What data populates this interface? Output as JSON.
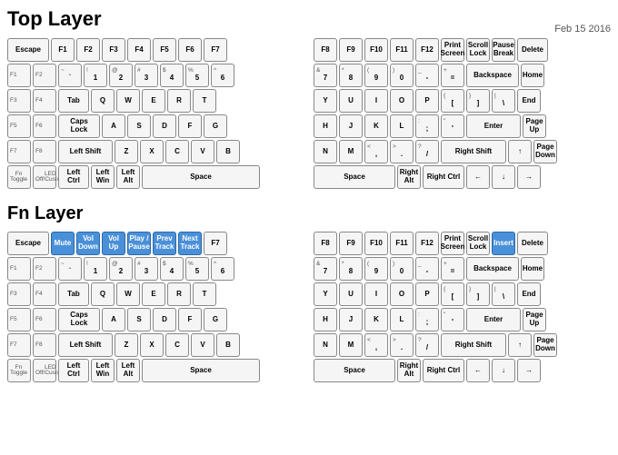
{
  "topLayer": {
    "title": "Top Layer",
    "date": "Feb 15 2016",
    "leftHalf": {
      "rows": [
        [
          {
            "label": "Escape",
            "w": "w2"
          },
          {
            "label": "F1",
            "w": "w1"
          },
          {
            "label": "F2",
            "w": "w1"
          },
          {
            "label": "F3",
            "w": "w1"
          },
          {
            "label": "F4",
            "w": "w1"
          },
          {
            "label": "F5",
            "w": "w1"
          },
          {
            "label": "F6",
            "w": "w1"
          },
          {
            "label": "F7",
            "w": "w1"
          }
        ],
        [
          {
            "top": "F1",
            "main": "F1",
            "w": "w1"
          },
          {
            "top": "F2",
            "main": "F2",
            "w": "w1"
          },
          {
            "top": "~",
            "bot": "`",
            "w": "w1"
          },
          {
            "top": "!",
            "bot": "1",
            "w": "w1"
          },
          {
            "top": "@",
            "bot": "2",
            "w": "w1"
          },
          {
            "top": "#",
            "bot": "3",
            "w": "w1"
          },
          {
            "top": "$",
            "bot": "4",
            "w": "w1"
          },
          {
            "top": "%",
            "bot": "5",
            "w": "w1"
          },
          {
            "top": "^",
            "bot": "6",
            "w": "w1"
          }
        ],
        [
          {
            "top": "F3",
            "main": "F3",
            "w": "w1"
          },
          {
            "top": "F4",
            "main": "F4",
            "w": "w1"
          },
          {
            "label": "Tab",
            "w": "w15"
          },
          {
            "label": "Q",
            "w": "w1"
          },
          {
            "label": "W",
            "w": "w1"
          },
          {
            "label": "E",
            "w": "w1"
          },
          {
            "label": "R",
            "w": "w1"
          },
          {
            "label": "T",
            "w": "w1"
          }
        ],
        [
          {
            "top": "F5",
            "main": "F5",
            "w": "w1"
          },
          {
            "top": "F6",
            "main": "F6",
            "w": "w1"
          },
          {
            "label": "Caps Lock",
            "w": "w2"
          },
          {
            "label": "A",
            "w": "w1"
          },
          {
            "label": "S",
            "w": "w1"
          },
          {
            "label": "D",
            "w": "w1"
          },
          {
            "label": "F",
            "w": "w1"
          },
          {
            "label": "G",
            "w": "w1"
          }
        ],
        [
          {
            "top": "F7",
            "main": "F7",
            "w": "w1"
          },
          {
            "top": "F8",
            "main": "F8",
            "w": "w1"
          },
          {
            "label": "Left Shift",
            "w": "w25"
          },
          {
            "label": "Z",
            "w": "w1"
          },
          {
            "label": "X",
            "w": "w1"
          },
          {
            "label": "C",
            "w": "w1"
          },
          {
            "label": "V",
            "w": "w1"
          },
          {
            "label": "B",
            "w": "w1"
          }
        ],
        [
          {
            "top": "Fn\nToggle",
            "main": "",
            "w": "w1"
          },
          {
            "top": "LED\nOff/Custom",
            "main": "",
            "w": "w1"
          },
          {
            "label": "Left Ctrl",
            "w": "w15"
          },
          {
            "label": "Left\nWin",
            "w": "w1"
          },
          {
            "label": "Left\nAlt",
            "w": "w1"
          },
          {
            "label": "Space",
            "w": "w-space"
          }
        ]
      ]
    },
    "rightHalf": {
      "rows": [
        [
          {
            "label": "F8",
            "w": "w1"
          },
          {
            "label": "F9",
            "w": "w1"
          },
          {
            "label": "F10",
            "w": "w1"
          },
          {
            "label": "F11",
            "w": "w1"
          },
          {
            "label": "F12",
            "w": "w1"
          },
          {
            "label": "Print\nScreen",
            "w": "w1"
          },
          {
            "label": "Scroll\nLock",
            "w": "w1"
          },
          {
            "label": "Pause\nBreak",
            "w": "w1"
          },
          {
            "label": "Delete",
            "w": "w15"
          }
        ],
        [
          {
            "top": "&",
            "bot": "7",
            "w": "w1"
          },
          {
            "top": "*",
            "bot": "8",
            "w": "w1"
          },
          {
            "top": "(",
            "bot": "9",
            "w": "w1"
          },
          {
            "top": ")",
            "bot": "0",
            "w": "w1"
          },
          {
            "top": "_",
            "bot": "-",
            "w": "w1"
          },
          {
            "top": "+",
            "bot": "=",
            "w": "w1"
          },
          {
            "label": "Backspace",
            "w": "w-backspace"
          },
          {
            "label": "Home",
            "w": "w1"
          }
        ],
        [
          {
            "label": "Y",
            "w": "w1"
          },
          {
            "label": "U",
            "w": "w1"
          },
          {
            "label": "I",
            "w": "w1"
          },
          {
            "label": "O",
            "w": "w1"
          },
          {
            "label": "P",
            "w": "w1"
          },
          {
            "top": "{",
            "bot": "[",
            "w": "w1"
          },
          {
            "top": "}",
            "bot": "]",
            "w": "w1"
          },
          {
            "top": "|",
            "bot": "\\",
            "w": "w1"
          },
          {
            "label": "End",
            "w": "w1"
          }
        ],
        [
          {
            "label": "H",
            "w": "w1"
          },
          {
            "label": "J",
            "w": "w1"
          },
          {
            "label": "K",
            "w": "w1"
          },
          {
            "label": "L",
            "w": "w1"
          },
          {
            "top": ":",
            "bot": ";",
            "w": "w1"
          },
          {
            "top": "\"",
            "bot": "'",
            "w": "w1"
          },
          {
            "label": "Enter",
            "w": "w25"
          },
          {
            "label": "Page\nUp",
            "w": "w1"
          }
        ],
        [
          {
            "label": "N",
            "w": "w1"
          },
          {
            "label": "M",
            "w": "w1"
          },
          {
            "top": "<",
            "bot": ",",
            "w": "w1"
          },
          {
            "top": ">",
            "bot": ".",
            "w": "w1"
          },
          {
            "top": "?",
            "bot": "/",
            "w": "w1"
          },
          {
            "label": "Right Shift",
            "w": "w3"
          },
          {
            "label": "↑",
            "w": "w1"
          },
          {
            "label": "Page\nDown",
            "w": "w1"
          }
        ],
        [
          {
            "label": "Space",
            "w": "w4"
          },
          {
            "label": "Right\nAlt",
            "w": "w1"
          },
          {
            "label": "Right Ctrl",
            "w": "w2"
          },
          {
            "label": "←",
            "w": "w1"
          },
          {
            "label": "↓",
            "w": "w1"
          },
          {
            "label": "→",
            "w": "w1"
          }
        ]
      ]
    }
  },
  "fnLayer": {
    "title": "Fn Layer",
    "leftHalf": {
      "rows": [
        [
          {
            "label": "Escape",
            "w": "w2"
          },
          {
            "label": "Mute",
            "w": "w1",
            "blue": true
          },
          {
            "label": "Vol\nDown",
            "w": "w1",
            "blue": true
          },
          {
            "label": "Vol\nUp",
            "w": "w1",
            "blue": true
          },
          {
            "label": "Play /\nPause",
            "w": "w1",
            "blue": true
          },
          {
            "label": "Prev\nTrack",
            "w": "w1",
            "blue": true
          },
          {
            "label": "Next\nTrack",
            "w": "w1",
            "blue": true
          },
          {
            "label": "F7",
            "w": "w1"
          }
        ],
        [
          {
            "top": "F1",
            "main": "F1",
            "w": "w1"
          },
          {
            "top": "F2",
            "main": "F2",
            "w": "w1"
          },
          {
            "top": "~",
            "bot": "`",
            "w": "w1"
          },
          {
            "top": "!",
            "bot": "1",
            "w": "w1"
          },
          {
            "top": "@",
            "bot": "2",
            "w": "w1"
          },
          {
            "top": "#",
            "bot": "3",
            "w": "w1"
          },
          {
            "top": "$",
            "bot": "4",
            "w": "w1"
          },
          {
            "top": "%",
            "bot": "5",
            "w": "w1"
          },
          {
            "top": "^",
            "bot": "6",
            "w": "w1"
          }
        ],
        [
          {
            "top": "F3",
            "main": "F3",
            "w": "w1"
          },
          {
            "top": "F4",
            "main": "F4",
            "w": "w1"
          },
          {
            "label": "Tab",
            "w": "w15"
          },
          {
            "label": "Q",
            "w": "w1"
          },
          {
            "label": "W",
            "w": "w1"
          },
          {
            "label": "E",
            "w": "w1"
          },
          {
            "label": "R",
            "w": "w1"
          },
          {
            "label": "T",
            "w": "w1"
          }
        ],
        [
          {
            "top": "F5",
            "main": "F5",
            "w": "w1"
          },
          {
            "top": "F6",
            "main": "F6",
            "w": "w1"
          },
          {
            "label": "Caps Lock",
            "w": "w2"
          },
          {
            "label": "A",
            "w": "w1"
          },
          {
            "label": "S",
            "w": "w1"
          },
          {
            "label": "D",
            "w": "w1"
          },
          {
            "label": "F",
            "w": "w1"
          },
          {
            "label": "G",
            "w": "w1"
          }
        ],
        [
          {
            "top": "F7",
            "main": "F7",
            "w": "w1"
          },
          {
            "top": "F8",
            "main": "F8",
            "w": "w1"
          },
          {
            "label": "Left Shift",
            "w": "w25"
          },
          {
            "label": "Z",
            "w": "w1"
          },
          {
            "label": "X",
            "w": "w1"
          },
          {
            "label": "C",
            "w": "w1"
          },
          {
            "label": "V",
            "w": "w1"
          },
          {
            "label": "B",
            "w": "w1"
          }
        ],
        [
          {
            "top": "Fn\nToggle",
            "main": "",
            "w": "w1"
          },
          {
            "top": "LED\nOff/Custom",
            "main": "",
            "w": "w1"
          },
          {
            "label": "Left Ctrl",
            "w": "w15"
          },
          {
            "label": "Left\nWin",
            "w": "w1"
          },
          {
            "label": "Left\nAlt",
            "w": "w1"
          },
          {
            "label": "Space",
            "w": "w-space"
          }
        ]
      ]
    },
    "rightHalf": {
      "rows": [
        [
          {
            "label": "F8",
            "w": "w1"
          },
          {
            "label": "F9",
            "w": "w1"
          },
          {
            "label": "F10",
            "w": "w1"
          },
          {
            "label": "F11",
            "w": "w1"
          },
          {
            "label": "F12",
            "w": "w1"
          },
          {
            "label": "Print\nScreen",
            "w": "w1"
          },
          {
            "label": "Scroll\nLock",
            "w": "w1"
          },
          {
            "label": "Insert",
            "w": "w1",
            "blue": true
          },
          {
            "label": "Delete",
            "w": "w15"
          }
        ],
        [
          {
            "top": "&",
            "bot": "7",
            "w": "w1"
          },
          {
            "top": "*",
            "bot": "8",
            "w": "w1"
          },
          {
            "top": "(",
            "bot": "9",
            "w": "w1"
          },
          {
            "top": ")",
            "bot": "0",
            "w": "w1"
          },
          {
            "top": "_",
            "bot": "-",
            "w": "w1"
          },
          {
            "top": "+",
            "bot": "=",
            "w": "w1"
          },
          {
            "label": "Backspace",
            "w": "w-backspace"
          },
          {
            "label": "Home",
            "w": "w1"
          }
        ],
        [
          {
            "label": "Y",
            "w": "w1"
          },
          {
            "label": "U",
            "w": "w1"
          },
          {
            "label": "I",
            "w": "w1"
          },
          {
            "label": "O",
            "w": "w1"
          },
          {
            "label": "P",
            "w": "w1"
          },
          {
            "top": "{",
            "bot": "[",
            "w": "w1"
          },
          {
            "top": "}",
            "bot": "]",
            "w": "w1"
          },
          {
            "top": "|",
            "bot": "\\",
            "w": "w1"
          },
          {
            "label": "End",
            "w": "w1"
          }
        ],
        [
          {
            "label": "H",
            "w": "w1"
          },
          {
            "label": "J",
            "w": "w1"
          },
          {
            "label": "K",
            "w": "w1"
          },
          {
            "label": "L",
            "w": "w1"
          },
          {
            "top": ":",
            "bot": ";",
            "w": "w1"
          },
          {
            "top": "\"",
            "bot": "'",
            "w": "w1"
          },
          {
            "label": "Enter",
            "w": "w25"
          },
          {
            "label": "Page\nUp",
            "w": "w1"
          }
        ],
        [
          {
            "label": "N",
            "w": "w1"
          },
          {
            "label": "M",
            "w": "w1"
          },
          {
            "top": "<",
            "bot": ",",
            "w": "w1"
          },
          {
            "top": ">",
            "bot": ".",
            "w": "w1"
          },
          {
            "top": "?",
            "bot": "/",
            "w": "w1"
          },
          {
            "label": "Right Shift",
            "w": "w3"
          },
          {
            "label": "↑",
            "w": "w1"
          },
          {
            "label": "Page\nDown",
            "w": "w1"
          }
        ],
        [
          {
            "label": "Space",
            "w": "w4"
          },
          {
            "label": "Right\nAlt",
            "w": "w1"
          },
          {
            "label": "Right Ctrl",
            "w": "w2"
          },
          {
            "label": "←",
            "w": "w1"
          },
          {
            "label": "↓",
            "w": "w1"
          },
          {
            "label": "→",
            "w": "w1"
          }
        ]
      ]
    }
  }
}
